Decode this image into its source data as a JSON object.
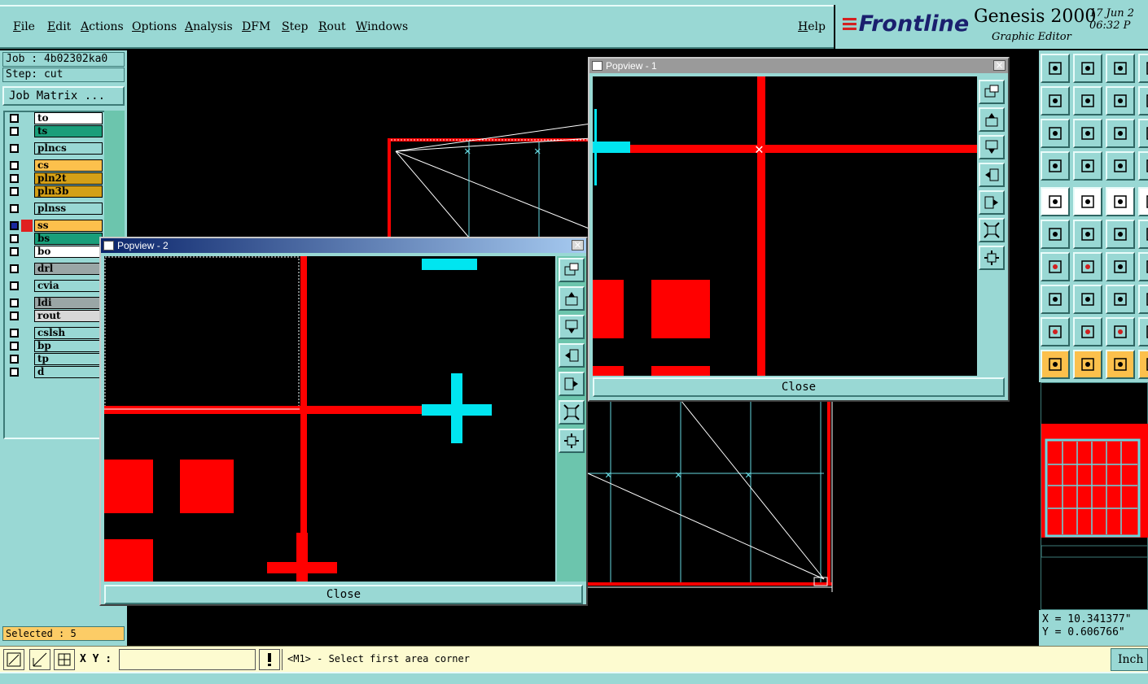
{
  "menu": {
    "items": [
      "File",
      "Edit",
      "Actions",
      "Options",
      "Analysis",
      "DFM",
      "Step",
      "Rout",
      "Windows"
    ],
    "help": "Help"
  },
  "brand": {
    "logo": "Frontline",
    "product": "Genesis 2000",
    "subtitle": "Graphic Editor",
    "date": "17 Jun 2",
    "time": "06:32 P"
  },
  "job": {
    "job_line": "Job : 4b02302ka0",
    "step_line": "Step: cut",
    "matrix_button": "Job Matrix ..."
  },
  "layers": [
    {
      "name": "to",
      "color": "#ffffff"
    },
    {
      "name": "ts",
      "color": "#1a9e7a"
    },
    {
      "name": "plncs",
      "color": "#99d8d4"
    },
    {
      "name": "cs",
      "color": "#fcc04c"
    },
    {
      "name": "pln2t",
      "color": "#d4a017"
    },
    {
      "name": "pln3b",
      "color": "#d4a017"
    },
    {
      "name": "plnss",
      "color": "#99d8d4"
    },
    {
      "name": "ss",
      "color": "#fcc04c"
    },
    {
      "name": "bs",
      "color": "#1a9e7a"
    },
    {
      "name": "bo",
      "color": "#ffffff"
    },
    {
      "name": "drl",
      "color": "#9aa6a6"
    },
    {
      "name": "cvia",
      "color": "#99d8d4"
    },
    {
      "name": "ldi",
      "color": "#9aa6a6"
    },
    {
      "name": "rout",
      "color": "#d8d8d8"
    },
    {
      "name": "cslsh",
      "color": "#99d8d4"
    },
    {
      "name": "bp",
      "color": "#99d8d4"
    },
    {
      "name": "tp",
      "color": "#99d8d4"
    },
    {
      "name": "d",
      "color": "#99d8d4"
    }
  ],
  "selected_text": "Selected : 5",
  "coords": {
    "x": "X = 10.341377\"",
    "y": "Y = 0.606766\""
  },
  "bottom": {
    "xy_label": "X Y :",
    "xy_value": "",
    "message": "<M1> - Select first area corner",
    "units": "Inch"
  },
  "popview1": {
    "title": "Popview - 1",
    "close_label": "Close",
    "close_x": "×"
  },
  "popview2": {
    "title": "Popview - 2",
    "close_label": "Close",
    "close_x": "×"
  },
  "colors": {
    "panel": "#99d8d4",
    "copper_red": "#ff0000",
    "cyan": "#00e5f0",
    "selected_bg": "#fccc66",
    "message_bg": "#fdfbd0"
  }
}
